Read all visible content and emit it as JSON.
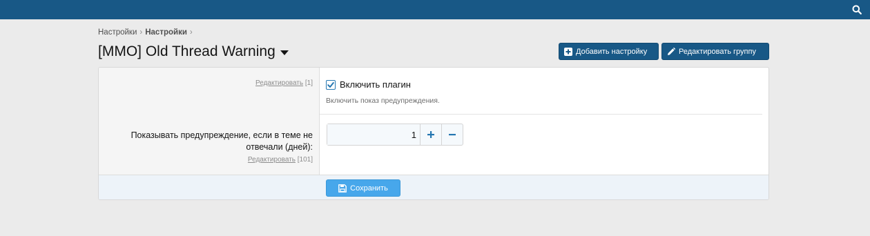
{
  "header": {
    "bar_color": "#185886",
    "search_icon": "search-icon"
  },
  "breadcrumb": {
    "items": [
      "Настройки",
      "Настройки"
    ],
    "separator": "›"
  },
  "page": {
    "title": "[MMO] Old Thread Warning"
  },
  "actions": {
    "add_setting_label": "Добавить настройку",
    "edit_group_label": "Редактировать группу"
  },
  "settings": {
    "row1": {
      "edit_link": "Редактировать",
      "order": "[1]",
      "checkbox_label": "Включить плагин",
      "checked": true,
      "hint": "Включить показ предупреждения."
    },
    "row2": {
      "label": "Показывать предупреждение, если в теме не отвечали (дней):",
      "edit_link": "Редактировать",
      "order": "[101]",
      "value": "1",
      "increment_icon": "plus-icon",
      "decrement_icon": "minus-icon"
    }
  },
  "footer": {
    "save_label": "Сохранить"
  },
  "colors": {
    "primary": "#185886",
    "save_button": "#47a7eb",
    "accent": "#2577b1"
  }
}
